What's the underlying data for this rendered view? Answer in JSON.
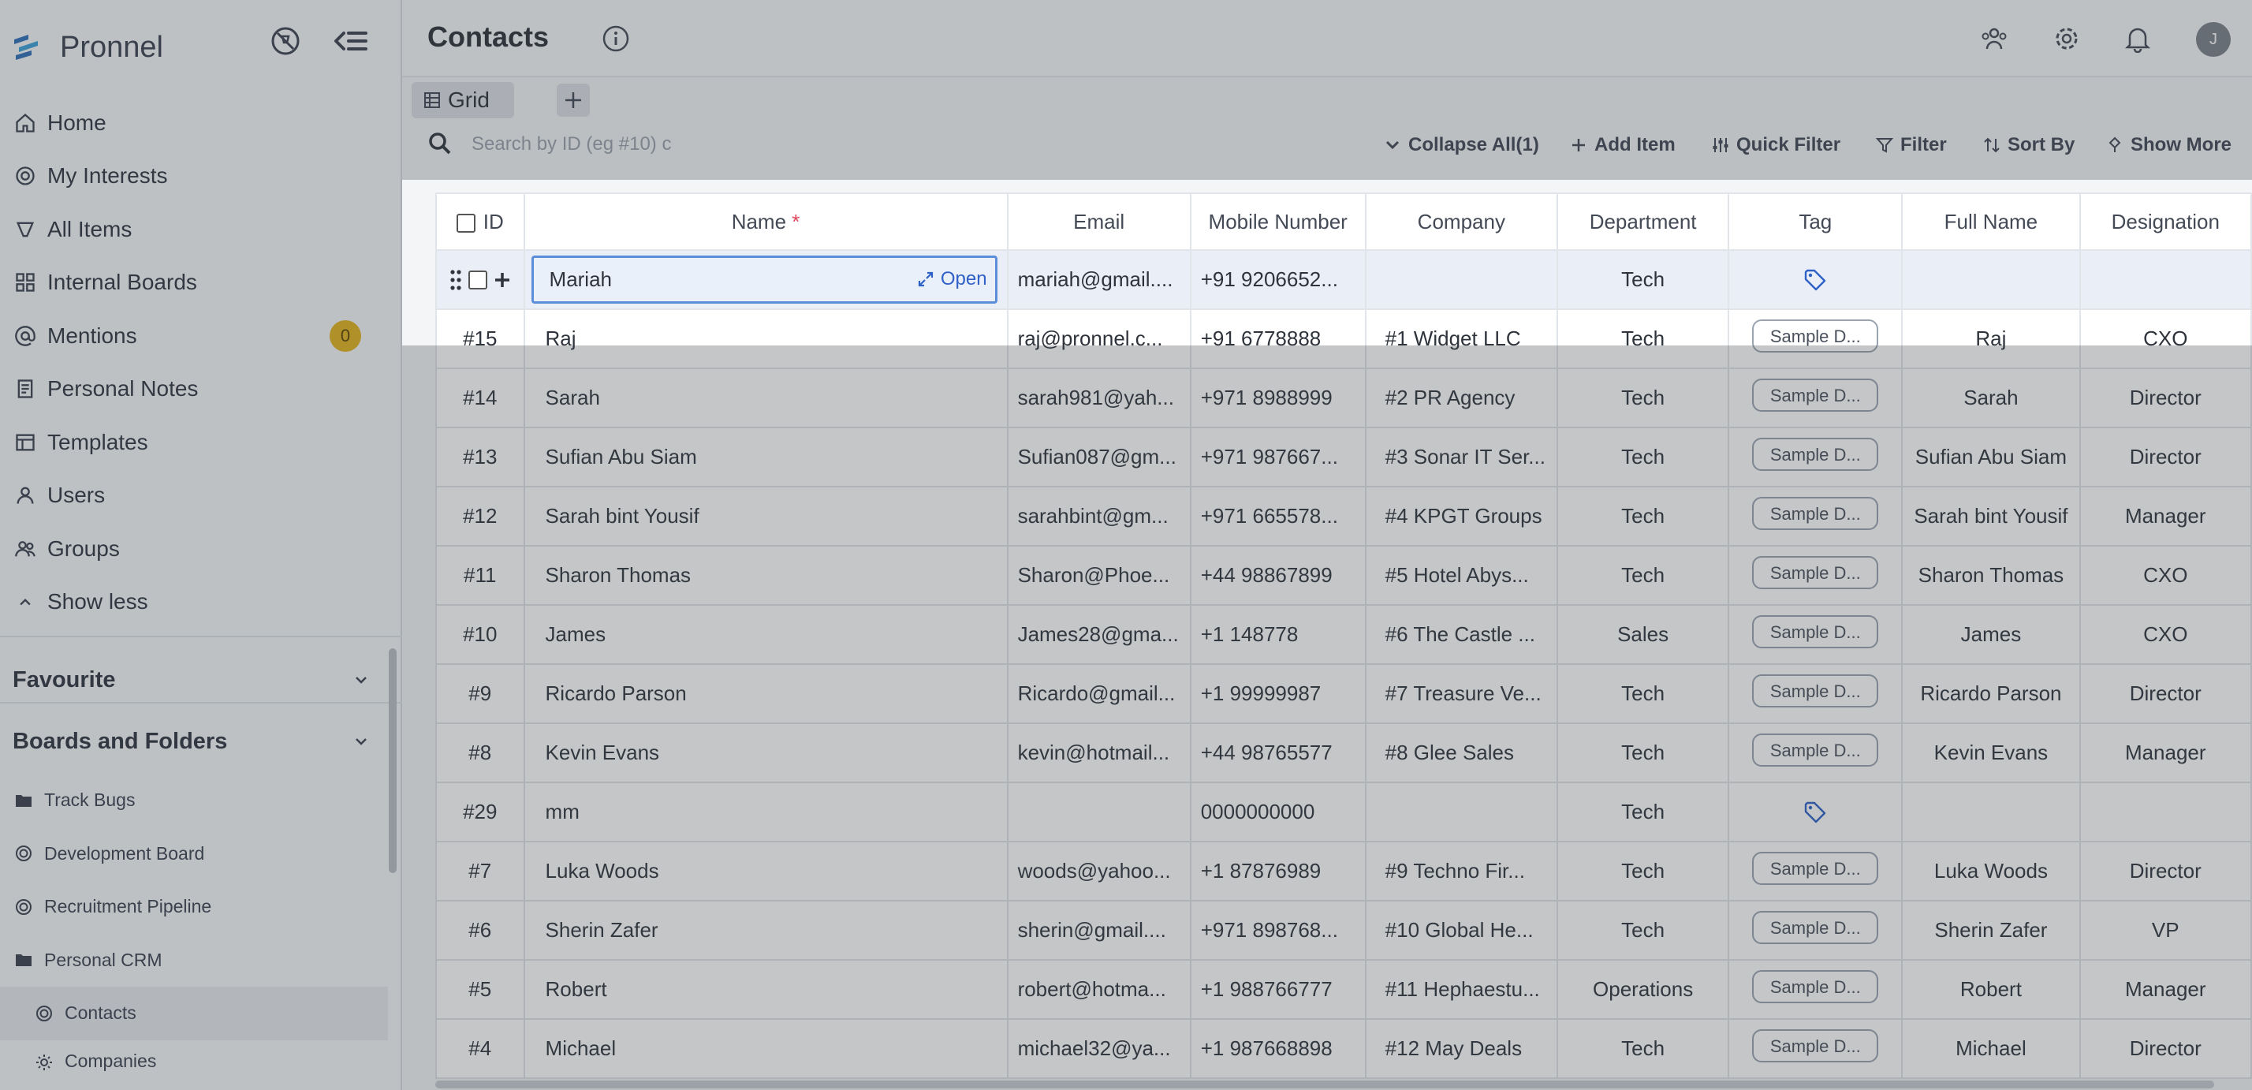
{
  "app": {
    "name": "Pronnel"
  },
  "sidebar": {
    "nav": [
      {
        "label": "Home",
        "icon": "home-icon"
      },
      {
        "label": "My Interests",
        "icon": "interests-icon"
      },
      {
        "label": "All Items",
        "icon": "all-items-icon"
      },
      {
        "label": "Internal Boards",
        "icon": "boards-icon"
      },
      {
        "label": "Mentions",
        "icon": "at-icon",
        "badge": "0"
      },
      {
        "label": "Personal Notes",
        "icon": "notes-icon"
      },
      {
        "label": "Templates",
        "icon": "templates-icon"
      },
      {
        "label": "Users",
        "icon": "user-icon"
      },
      {
        "label": "Groups",
        "icon": "groups-icon"
      },
      {
        "label": "Show less",
        "icon": "chevron-up-icon"
      }
    ],
    "favourite_label": "Favourite",
    "boards_folders_label": "Boards and Folders",
    "boards": [
      {
        "label": "Track Bugs",
        "icon": "folder-icon"
      },
      {
        "label": "Development Board",
        "icon": "board-icon"
      },
      {
        "label": "Recruitment Pipeline",
        "icon": "board-icon"
      },
      {
        "label": "Personal CRM",
        "icon": "folder-icon"
      },
      {
        "label": "Contacts",
        "icon": "board-icon",
        "active": true
      },
      {
        "label": "Companies",
        "icon": "sun-icon"
      }
    ]
  },
  "header": {
    "title": "Contacts",
    "avatar_initial": "J"
  },
  "tabs": {
    "grid_label": "Grid"
  },
  "toolbar": {
    "search_placeholder": "Search by ID (eg #10) c",
    "collapse_all": "Collapse All(1)",
    "add_item": "Add Item",
    "quick_filter": "Quick Filter",
    "filter": "Filter",
    "sort_by": "Sort By",
    "show_more": "Show More"
  },
  "grid": {
    "columns": {
      "id": "ID",
      "name": "Name",
      "name_required": "*",
      "email": "Email",
      "mobile": "Mobile Number",
      "company": "Company",
      "department": "Department",
      "tag": "Tag",
      "full_name": "Full Name",
      "designation": "Designation"
    },
    "open_label": "Open",
    "active_row": {
      "name": "Mariah",
      "email": "mariah@gmail....",
      "mobile": "+91 9206652...",
      "company": "",
      "department": "Tech",
      "tag": "icon",
      "full_name": "",
      "designation": ""
    },
    "rows": [
      {
        "id": "#15",
        "name": "Raj",
        "email": "raj@pronnel.c...",
        "mobile": "+91 6778888",
        "company": "#1 Widget LLC",
        "department": "Tech",
        "tag": "Sample D...",
        "full_name": "Raj",
        "designation": "CXO"
      },
      {
        "id": "#14",
        "name": "Sarah",
        "email": "sarah981@yah...",
        "mobile": "+971 8988999",
        "company": "#2 PR Agency",
        "department": "Tech",
        "tag": "Sample D...",
        "full_name": "Sarah",
        "designation": "Director"
      },
      {
        "id": "#13",
        "name": "Sufian Abu Siam",
        "email": "Sufian087@gm...",
        "mobile": "+971 987667...",
        "company": "#3 Sonar IT Ser...",
        "department": "Tech",
        "tag": "Sample D...",
        "full_name": "Sufian Abu Siam",
        "designation": "Director"
      },
      {
        "id": "#12",
        "name": "Sarah bint Yousif",
        "email": "sarahbint@gm...",
        "mobile": "+971 665578...",
        "company": "#4 KPGT Groups",
        "department": "Tech",
        "tag": "Sample D...",
        "full_name": "Sarah bint Yousif",
        "designation": "Manager"
      },
      {
        "id": "#11",
        "name": "Sharon Thomas",
        "email": "Sharon@Phoe...",
        "mobile": "+44 98867899",
        "company": "#5 Hotel Abys...",
        "department": "Tech",
        "tag": "Sample D...",
        "full_name": "Sharon Thomas",
        "designation": "CXO"
      },
      {
        "id": "#10",
        "name": "James",
        "email": "James28@gma...",
        "mobile": "+1 148778",
        "company": "#6 The Castle ...",
        "department": "Sales",
        "tag": "Sample D...",
        "full_name": "James",
        "designation": "CXO"
      },
      {
        "id": "#9",
        "name": "Ricardo Parson",
        "email": "Ricardo@gmail...",
        "mobile": "+1 99999987",
        "company": "#7 Treasure Ve...",
        "department": "Tech",
        "tag": "Sample D...",
        "full_name": "Ricardo Parson",
        "designation": "Director"
      },
      {
        "id": "#8",
        "name": "Kevin Evans",
        "email": "kevin@hotmail...",
        "mobile": "+44 98765577",
        "company": "#8 Glee Sales",
        "department": "Tech",
        "tag": "Sample D...",
        "full_name": "Kevin Evans",
        "designation": "Manager"
      },
      {
        "id": "#29",
        "name": "mm",
        "email": "",
        "mobile": "0000000000",
        "company": "",
        "department": "Tech",
        "tag": "icon",
        "full_name": "",
        "designation": ""
      },
      {
        "id": "#7",
        "name": "Luka Woods",
        "email": "woods@yahoo...",
        "mobile": "+1 87876989",
        "company": "#9 Techno Fir...",
        "department": "Tech",
        "tag": "Sample D...",
        "full_name": "Luka Woods",
        "designation": "Director"
      },
      {
        "id": "#6",
        "name": "Sherin Zafer",
        "email": "sherin@gmail....",
        "mobile": "+971 898768...",
        "company": "#10 Global He...",
        "department": "Tech",
        "tag": "Sample D...",
        "full_name": "Sherin Zafer",
        "designation": "VP"
      },
      {
        "id": "#5",
        "name": "Robert",
        "email": "robert@hotma...",
        "mobile": "+1 988766777",
        "company": "#11 Hephaestu...",
        "department": "Operations",
        "tag": "Sample D...",
        "full_name": "Robert",
        "designation": "Manager"
      },
      {
        "id": "#4",
        "name": "Michael",
        "email": "michael32@ya...",
        "mobile": "+1 987668898",
        "company": "#12 May Deals",
        "department": "Tech",
        "tag": "Sample D...",
        "full_name": "Michael",
        "designation": "Director"
      }
    ]
  },
  "colors": {
    "accent": "#2f61c7",
    "badge": "#e3b21a",
    "required": "#e0445a"
  }
}
